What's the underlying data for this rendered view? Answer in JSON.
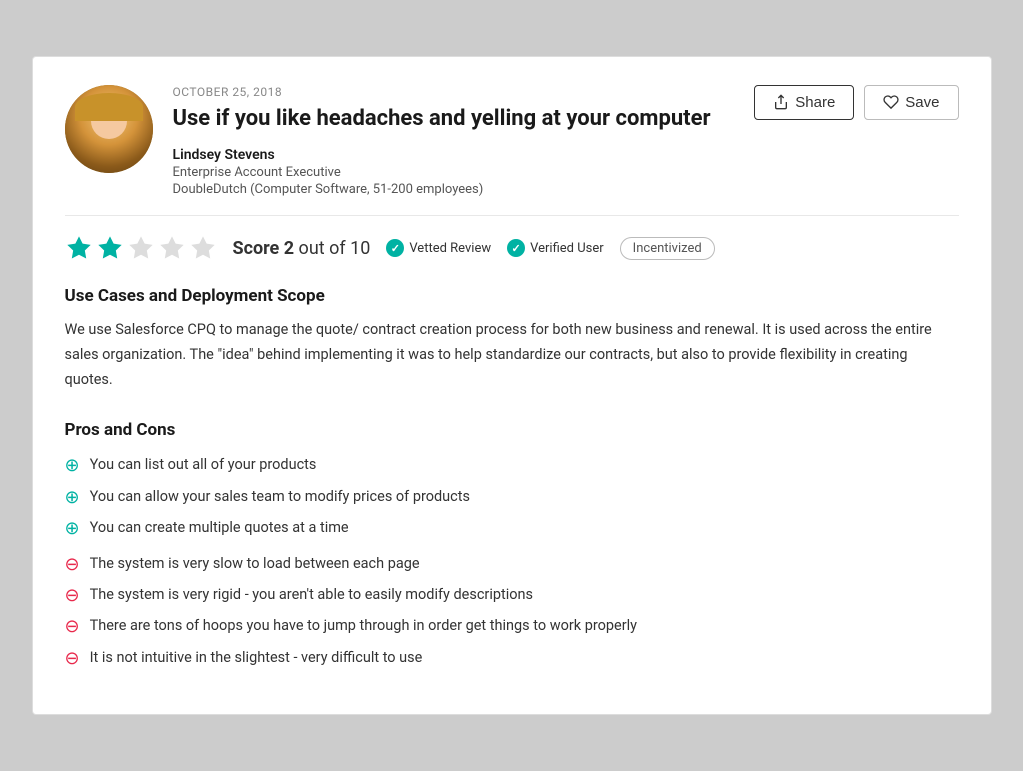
{
  "header": {
    "date": "OCTOBER 25, 2018",
    "title": "Use if you like headaches and yelling at your computer",
    "author": {
      "name": "Lindsey Stevens",
      "job_title": "Enterprise Account Executive",
      "company": "DoubleDutch (Computer Software, 51-200 employees)"
    },
    "buttons": {
      "share": "Share",
      "save": "Save"
    }
  },
  "rating": {
    "score": "2",
    "out_of": "out of 10",
    "score_label": "Score",
    "stars_filled": 2,
    "stars_empty": 3,
    "vetted_label": "Vetted Review",
    "verified_label": "Verified User",
    "incentivized_label": "Incentivized"
  },
  "use_cases": {
    "title": "Use Cases and Deployment Scope",
    "text": "We use Salesforce CPQ to manage the quote/ contract creation process for both new business and renewal. It is used across the entire sales organization. The \"idea\" behind implementing it was to help standardize our contracts, but also to provide flexibility in creating quotes."
  },
  "pros_cons": {
    "title": "Pros and Cons",
    "pros": [
      "You can list out all of your products",
      "You can allow your sales team to modify prices of products",
      "You can create multiple quotes at a time"
    ],
    "cons": [
      "The system is very slow to load between each page",
      "The system is very rigid - you aren't able to easily modify descriptions",
      "There are tons of hoops you have to jump through in order get things to work properly",
      "It is not intuitive in the slightest - very difficult to use"
    ]
  }
}
